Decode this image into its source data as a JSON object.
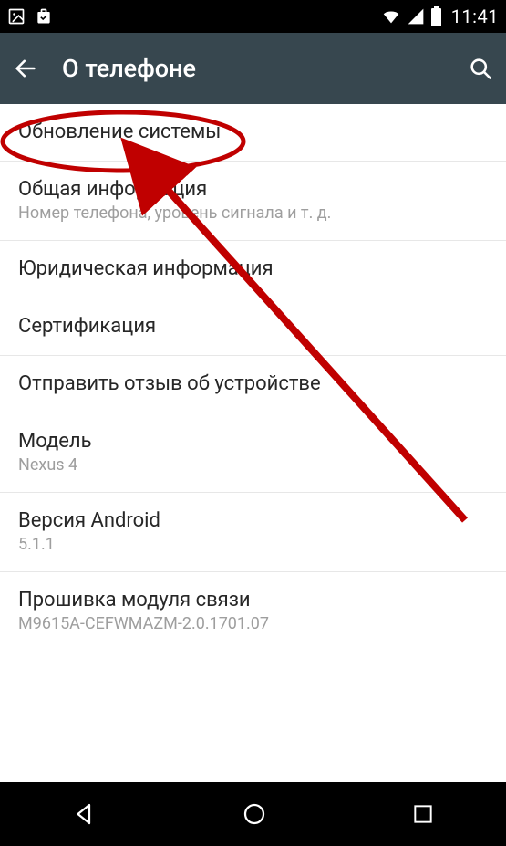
{
  "status": {
    "time": "11:41"
  },
  "header": {
    "title": "О телефоне"
  },
  "items": [
    {
      "title": "Обновление системы",
      "subtitle": ""
    },
    {
      "title": "Общая информация",
      "subtitle": "Номер телефона, уровень сигнала и т. д."
    },
    {
      "title": "Юридическая информация",
      "subtitle": ""
    },
    {
      "title": "Сертификация",
      "subtitle": ""
    },
    {
      "title": "Отправить отзыв об устройстве",
      "subtitle": ""
    },
    {
      "title": "Модель",
      "subtitle": "Nexus 4"
    },
    {
      "title": "Версия Android",
      "subtitle": "5.1.1"
    },
    {
      "title": "Прошивка модуля связи",
      "subtitle": "M9615A-CEFWMAZM-2.0.1701.07"
    }
  ]
}
